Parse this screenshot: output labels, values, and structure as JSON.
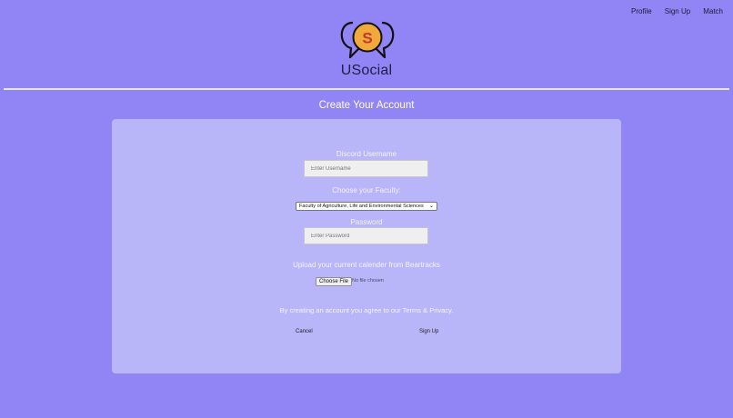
{
  "nav": {
    "profile": "Profile",
    "sign_up": "Sign Up",
    "match": "Match"
  },
  "brand": {
    "logo_letter": "S",
    "name": "USocial"
  },
  "page_title": "Create Your Account",
  "form": {
    "username_label": "Discord Username",
    "username_placeholder": "Enter Username",
    "faculty_label": "Choose your Faculty:",
    "faculty_selected": "Faculty of Agriculture, Life and Environmental Sciences",
    "password_label": "Password",
    "password_placeholder": "Enter Password",
    "upload_label": "Upload your current calender from Beartracks",
    "file_button": "Choose File",
    "file_status": "No file chosen",
    "terms_text": "By creating an account you agree to our Terms & Privacy.",
    "cancel": "Cancel",
    "sign_up": "Sign Up"
  },
  "colors": {
    "background": "#9184f4",
    "card": "#b9b5f9",
    "logo_coin": "#f2a93b",
    "logo_letter": "#c0392b"
  }
}
